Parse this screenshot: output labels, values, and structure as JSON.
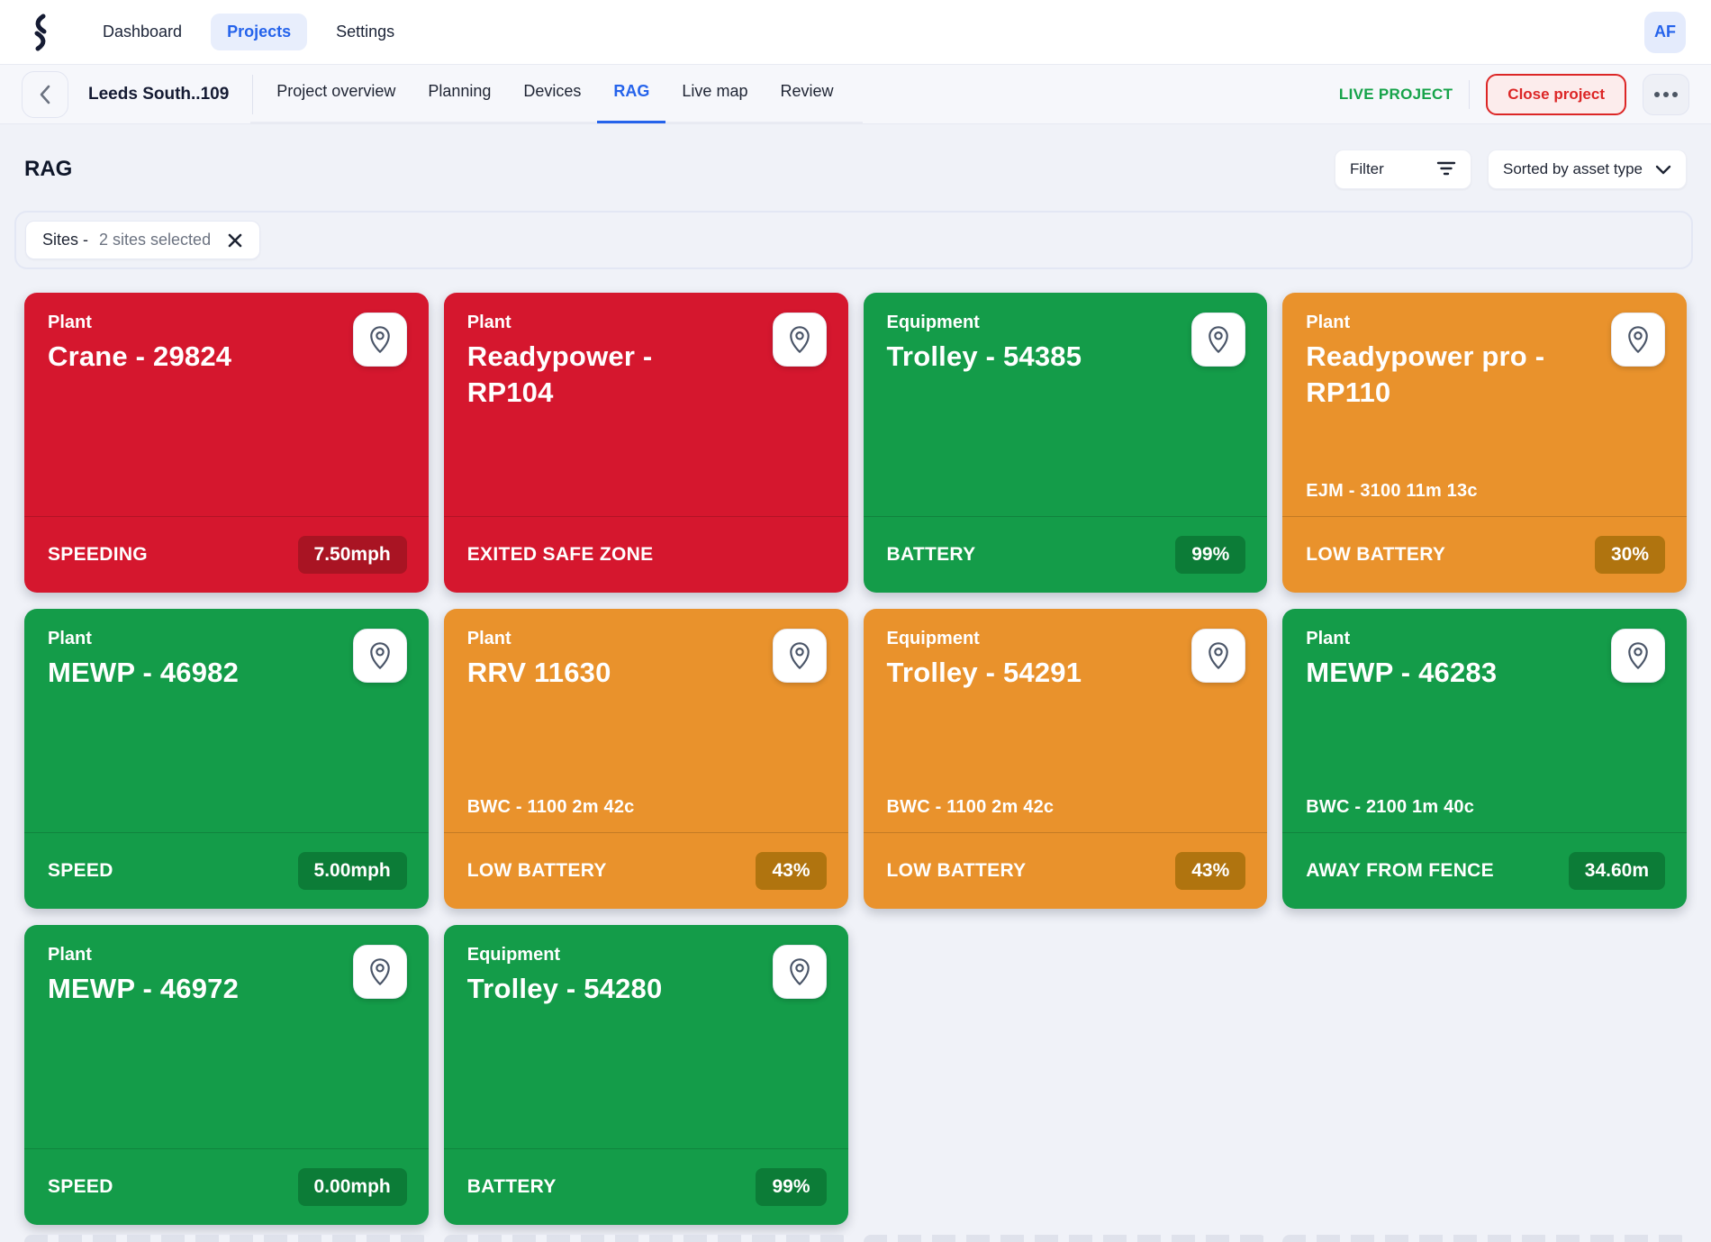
{
  "topnav": {
    "items": [
      {
        "label": "Dashboard",
        "active": false
      },
      {
        "label": "Projects",
        "active": true
      },
      {
        "label": "Settings",
        "active": false
      }
    ],
    "avatar": "AF"
  },
  "projectbar": {
    "title": "Leeds South..109",
    "tabs": [
      "Project overview",
      "Planning",
      "Devices",
      "RAG",
      "Live map",
      "Review"
    ],
    "active_tab": "RAG",
    "live_badge": "LIVE PROJECT",
    "close_button": "Close project"
  },
  "toolbar": {
    "page_title": "RAG",
    "filter_button": "Filter",
    "sort_dropdown": "Sorted by asset type"
  },
  "filter_chip": {
    "prefix": "Sites -",
    "value": "2 sites selected"
  },
  "colors": {
    "red": "#d5172e",
    "red_badge": "#a91423",
    "green": "#149c49",
    "green_badge": "#0c7c37",
    "amber": "#e9922c",
    "amber_badge": "#b0740f",
    "accent_blue": "#2563eb",
    "live_green": "#16a34a",
    "close_red": "#dc2626"
  },
  "cards": [
    {
      "category": "Plant",
      "name": "Crane - 29824",
      "status": "red",
      "info": "",
      "alert": "SPEEDING",
      "value": "7.50mph"
    },
    {
      "category": "Plant",
      "name": "Readypower - RP104",
      "status": "red",
      "info": "",
      "alert": "EXITED SAFE ZONE",
      "value": ""
    },
    {
      "category": "Equipment",
      "name": "Trolley - 54385",
      "status": "green",
      "info": "",
      "alert": "BATTERY",
      "value": "99%"
    },
    {
      "category": "Plant",
      "name": "Readypower pro - RP110",
      "status": "amber",
      "info": "EJM - 3100 11m 13c",
      "alert": "LOW BATTERY",
      "value": "30%"
    },
    {
      "category": "Plant",
      "name": "MEWP - 46982",
      "status": "green",
      "info": "",
      "alert": "SPEED",
      "value": "5.00mph"
    },
    {
      "category": "Plant",
      "name": "RRV 11630",
      "status": "amber",
      "info": "BWC - 1100 2m 42c",
      "alert": "LOW BATTERY",
      "value": "43%"
    },
    {
      "category": "Equipment",
      "name": "Trolley - 54291",
      "status": "amber",
      "info": "BWC - 1100 2m 42c",
      "alert": "LOW BATTERY",
      "value": "43%"
    },
    {
      "category": "Plant",
      "name": "MEWP - 46283",
      "status": "green",
      "info": "BWC - 2100 1m 40c",
      "alert": "AWAY FROM FENCE",
      "value": "34.60m"
    },
    {
      "category": "Plant",
      "name": "MEWP - 46972",
      "status": "green",
      "info": "",
      "alert": "SPEED",
      "value": "0.00mph"
    },
    {
      "category": "Equipment",
      "name": "Trolley - 54280",
      "status": "green",
      "info": "",
      "alert": "BATTERY",
      "value": "99%"
    }
  ]
}
